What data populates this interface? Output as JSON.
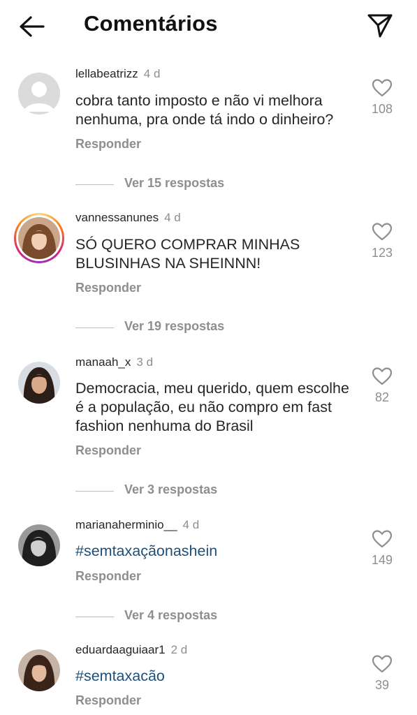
{
  "header": {
    "back_icon": "arrow-left-icon",
    "title": "Comentários",
    "send_icon": "paper-plane-icon"
  },
  "comments": [
    {
      "username": "lellabeatrizz",
      "time": "4 d",
      "text": "cobra tanto imposto e não vi melhora nenhuma, pra onde tá indo o dinheiro?",
      "likes": "108",
      "reply_label": "Responder",
      "view_replies": "Ver 15 respostas",
      "avatar": "default-avatar"
    },
    {
      "username": "vannessanunes",
      "time": "4 d",
      "text": "SÓ QUERO COMPRAR MINHAS BLUSINHAS NA SHEINNN!",
      "likes": "123",
      "reply_label": "Responder",
      "view_replies": "Ver 19 respostas",
      "avatar": "photo-avatar",
      "story_ring": true
    },
    {
      "username": "manaah_x",
      "time": "3 d",
      "text": "Democracia, meu querido, quem escolhe é a população, eu não compro em fast fashion nenhuma do Brasil",
      "likes": "82",
      "reply_label": "Responder",
      "view_replies": "Ver 3 respostas",
      "avatar": "photo-avatar"
    },
    {
      "username": "marianaherminio__",
      "time": "4 d",
      "text": "#semtaxaçãonashein",
      "likes": "149",
      "reply_label": "Responder",
      "view_replies": "Ver 4 respostas",
      "avatar": "photo-avatar"
    },
    {
      "username": "eduardaaguiaar1",
      "time": "2 d",
      "text": "#semtaxacão",
      "likes": "39",
      "reply_label": "Responder",
      "avatar": "photo-avatar"
    }
  ],
  "colors": {
    "hashtag": "#1e4f7a",
    "secondary_text": "#8e8e8e",
    "primary_text": "#262626"
  }
}
